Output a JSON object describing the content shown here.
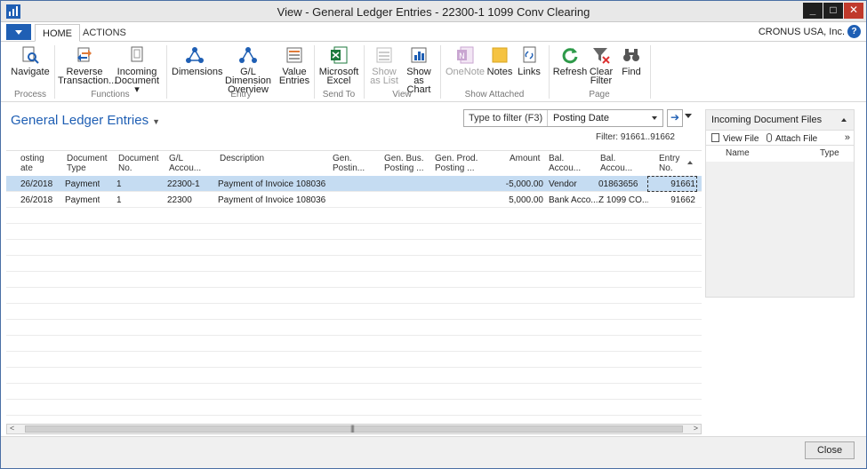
{
  "window": {
    "title": "View - General Ledger Entries - 22300-1 1099 Conv Clearing"
  },
  "tabs": [
    {
      "label": "HOME"
    },
    {
      "label": "ACTIONS"
    }
  ],
  "company": "CRONUS USA, Inc.",
  "help_label": "?",
  "ribbon": {
    "buttons": {
      "navigate": {
        "line1": "Navigate",
        "line2": "",
        "icon": "navigate-icon"
      },
      "reverse": {
        "line1": "Reverse",
        "line2": "Transaction...",
        "icon": "reverse-transaction-icon"
      },
      "incoming": {
        "line1": "Incoming",
        "line2": "Document ▾",
        "icon": "incoming-document-icon"
      },
      "dimensions": {
        "line1": "Dimensions",
        "line2": "",
        "icon": "dimensions-icon"
      },
      "gl_dimension": {
        "line1": "G/L Dimension",
        "line2": "Overview",
        "icon": "gl-dimension-icon"
      },
      "value_entries": {
        "line1": "Value",
        "line2": "Entries",
        "icon": "value-entries-icon"
      },
      "excel": {
        "line1": "Microsoft",
        "line2": "Excel",
        "icon": "excel-icon"
      },
      "show_list": {
        "line1": "Show",
        "line2": "as List",
        "icon": "show-list-icon"
      },
      "show_chart": {
        "line1": "Show as",
        "line2": "Chart",
        "icon": "show-chart-icon"
      },
      "onenote": {
        "line1": "OneNote",
        "line2": "",
        "icon": "onenote-icon"
      },
      "notes": {
        "line1": "Notes",
        "line2": "",
        "icon": "notes-icon"
      },
      "links": {
        "line1": "Links",
        "line2": "",
        "icon": "links-icon"
      },
      "refresh": {
        "line1": "Refresh",
        "line2": "",
        "icon": "refresh-icon"
      },
      "clear_filter": {
        "line1": "Clear",
        "line2": "Filter",
        "icon": "clear-filter-icon"
      },
      "find": {
        "line1": "Find",
        "line2": "",
        "icon": "find-icon"
      }
    },
    "groups": {
      "process": "Process",
      "functions": "Functions",
      "entry": "Entry",
      "send_to": "Send To",
      "view": "View",
      "show_attached": "Show Attached",
      "page": "Page"
    }
  },
  "page": {
    "title": "General Ledger Entries",
    "filter_placeholder": "Type to filter (F3)",
    "filter_field": "Posting Date",
    "filter_info": "Filter: 91661..91662"
  },
  "columns": [
    {
      "l1": "osting",
      "l2": "ate"
    },
    {
      "l1": "Document",
      "l2": "Type"
    },
    {
      "l1": "Document",
      "l2": "No."
    },
    {
      "l1": "G/L",
      "l2": "Accou..."
    },
    {
      "l1": "Description",
      "l2": ""
    },
    {
      "l1": "Gen.",
      "l2": "Postin..."
    },
    {
      "l1": "Gen. Bus.",
      "l2": "Posting ..."
    },
    {
      "l1": "Gen. Prod.",
      "l2": "Posting ..."
    },
    {
      "l1": "Amount",
      "l2": ""
    },
    {
      "l1": "Bal.",
      "l2": "Accou..."
    },
    {
      "l1": "Bal.",
      "l2": "Accou..."
    },
    {
      "l1": "Entry",
      "l2": "No."
    }
  ],
  "rows": [
    [
      "26/2018",
      "Payment",
      "1",
      "22300-1",
      "Payment of Invoice 108036",
      "",
      "",
      "",
      "-5,000.00",
      "Vendor",
      "01863656",
      "91661"
    ],
    [
      "26/2018",
      "Payment",
      "1",
      "22300",
      "Payment of Invoice 108036",
      "",
      "",
      "",
      "5,000.00",
      "Bank Acco...",
      "Z 1099 CO...",
      "91662"
    ]
  ],
  "factbox": {
    "title": "Incoming Document Files",
    "view_file": "View File",
    "attach_file": "Attach File",
    "more": "»",
    "col_name": "Name",
    "col_type": "Type"
  },
  "scroll": {
    "left": "<",
    "right": ">",
    "grip": "|||"
  },
  "footer": {
    "close_label": "Close"
  }
}
